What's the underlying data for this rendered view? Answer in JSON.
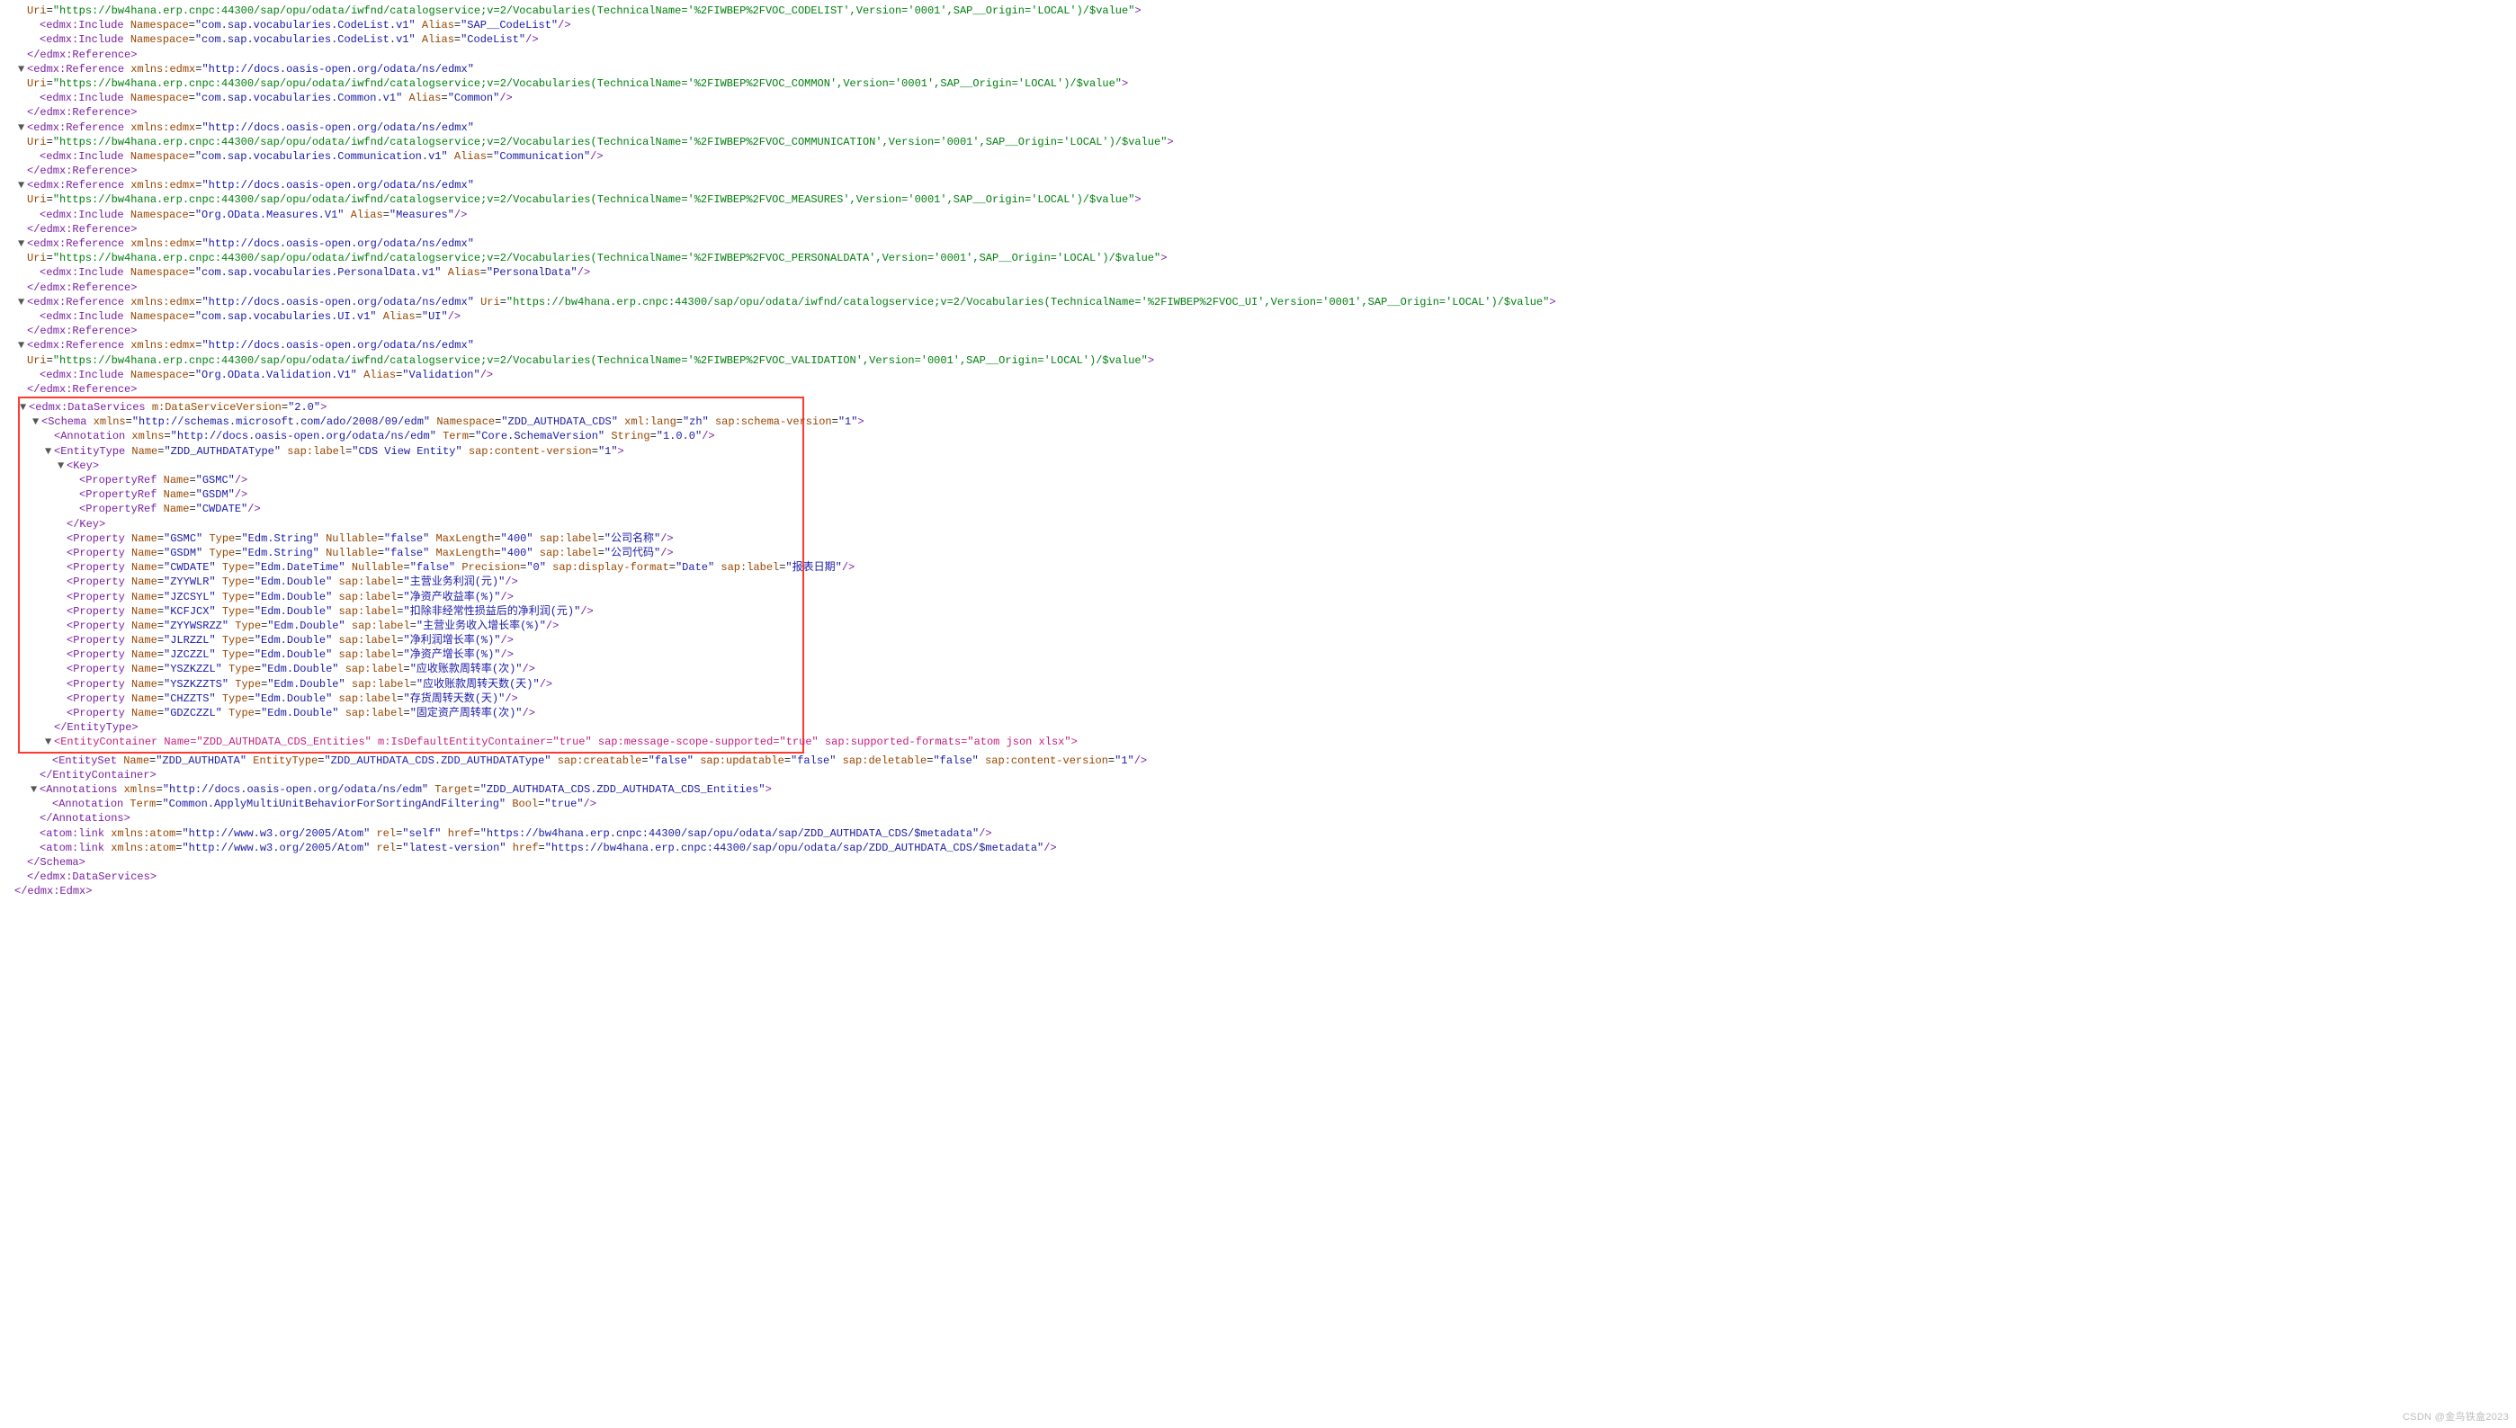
{
  "xmlnsEdmx": "http://docs.oasis-open.org/odata/ns/edmx",
  "baseUri": "https://bw4hana.erp.cnpc:44300/sap/opu/odata/iwfnd/catalogservice;v=2/Vocabularies(TechnicalName='",
  "uriTail": "',Version='0001',SAP__Origin='LOCAL')/$value",
  "refs": [
    {
      "tech": "%2FIWBEP%2FVOC_CODELIST",
      "ns": "com.sap.vocabularies.CodeList.v1",
      "alias": "SAP__CodeList",
      "extra": {
        "ns": "com.sap.vocabularies.CodeList.v1",
        "alias": "CodeList"
      }
    },
    {
      "tech": "%2FIWBEP%2FVOC_COMMON",
      "ns": "com.sap.vocabularies.Common.v1",
      "alias": "Common"
    },
    {
      "tech": "%2FIWBEP%2FVOC_COMMUNICATION",
      "ns": "com.sap.vocabularies.Communication.v1",
      "alias": "Communication"
    },
    {
      "tech": "%2FIWBEP%2FVOC_MEASURES",
      "ns": "Org.OData.Measures.V1",
      "alias": "Measures"
    },
    {
      "tech": "%2FIWBEP%2FVOC_PERSONALDATA",
      "ns": "com.sap.vocabularies.PersonalData.v1",
      "alias": "PersonalData"
    },
    {
      "tech": "%2FIWBEP%2FVOC_UI",
      "ns": "com.sap.vocabularies.UI.v1",
      "alias": "UI",
      "inlineUri": true
    },
    {
      "tech": "%2FIWBEP%2FVOC_VALIDATION",
      "ns": "Org.OData.Validation.V1",
      "alias": "Validation"
    }
  ],
  "ds": {
    "version": "2.0",
    "schema": {
      "xmlns": "http://schemas.microsoft.com/ado/2008/09/edm",
      "namespace": "ZDD_AUTHDATA_CDS",
      "lang": "zh",
      "schemaVersion": "1"
    },
    "annotation": {
      "xmlns": "http://docs.oasis-open.org/odata/ns/edm",
      "term": "Core.SchemaVersion",
      "string": "1.0.0"
    },
    "entityType": {
      "name": "ZDD_AUTHDATAType",
      "label": "CDS View Entity",
      "contentVersion": "1",
      "keys": [
        "GSMC",
        "GSDM",
        "CWDATE"
      ],
      "props": [
        {
          "name": "GSMC",
          "type": "Edm.String",
          "nullable": "false",
          "maxlen": "400",
          "label": "公司名称"
        },
        {
          "name": "GSDM",
          "type": "Edm.String",
          "nullable": "false",
          "maxlen": "400",
          "label": "公司代码"
        },
        {
          "name": "CWDATE",
          "type": "Edm.DateTime",
          "nullable": "false",
          "precision": "0",
          "dispfmt": "Date",
          "label": "报表日期"
        },
        {
          "name": "ZYYWLR",
          "type": "Edm.Double",
          "label": "主营业务利润(元)"
        },
        {
          "name": "JZCSYL",
          "type": "Edm.Double",
          "label": "净资产收益率(%)"
        },
        {
          "name": "KCFJCX",
          "type": "Edm.Double",
          "label": "扣除非经常性损益后的净利润(元)"
        },
        {
          "name": "ZYYWSRZZ",
          "type": "Edm.Double",
          "label": "主营业务收入增长率(%)"
        },
        {
          "name": "JLRZZL",
          "type": "Edm.Double",
          "label": "净利润增长率(%)"
        },
        {
          "name": "JZCZZL",
          "type": "Edm.Double",
          "label": "净资产增长率(%)"
        },
        {
          "name": "YSZKZZL",
          "type": "Edm.Double",
          "label": "应收账款周转率(次)"
        },
        {
          "name": "YSZKZZTS",
          "type": "Edm.Double",
          "label": "应收账款周转天数(天)"
        },
        {
          "name": "CHZZTS",
          "type": "Edm.Double",
          "label": "存货周转天数(天)"
        },
        {
          "name": "GDZCZZL",
          "type": "Edm.Double",
          "label": "固定资产周转率(次)"
        }
      ]
    },
    "entityContainer": {
      "name": "ZDD_AUTHDATA_CDS_Entities",
      "isDefault": "true",
      "msgScope": "true",
      "formats": "atom json xlsx",
      "set": {
        "name": "ZDD_AUTHDATA",
        "type": "ZDD_AUTHDATA_CDS.ZDD_AUTHDATAType",
        "creatable": "false",
        "updatable": "false",
        "deletable": "false",
        "contentVersion": "1"
      }
    },
    "annotations": {
      "xmlns": "http://docs.oasis-open.org/odata/ns/edm",
      "target": "ZDD_AUTHDATA_CDS.ZDD_AUTHDATA_CDS_Entities",
      "term": "Common.ApplyMultiUnitBehaviorForSortingAndFiltering",
      "bool": "true"
    },
    "atom": {
      "ns": "http://www.w3.org/2005/Atom",
      "selfHref": "https://bw4hana.erp.cnpc:44300/sap/opu/odata/sap/ZDD_AUTHDATA_CDS/$metadata",
      "latestHref": "https://bw4hana.erp.cnpc:44300/sap/opu/odata/sap/ZDD_AUTHDATA_CDS/$metadata"
    }
  },
  "watermark": "CSDN @金鸟铁盒2023"
}
